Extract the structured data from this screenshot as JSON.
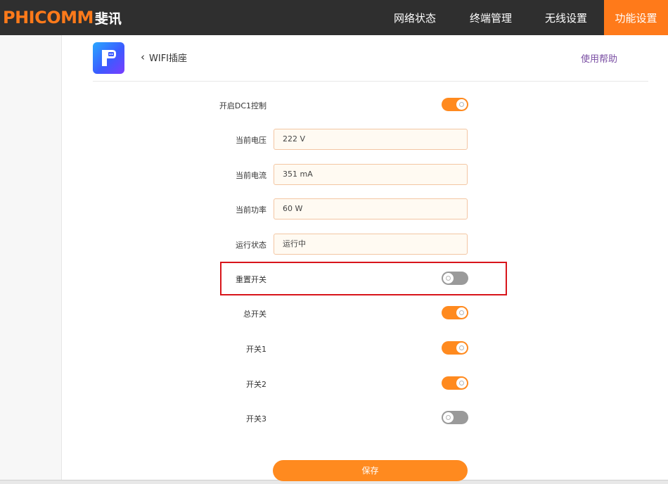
{
  "brand": {
    "name_en": "PHICOMM",
    "name_cn": "斐讯",
    "accent_color": "#ff7a1a"
  },
  "nav": [
    {
      "label": "网络状态",
      "active": false
    },
    {
      "label": "终端管理",
      "active": false
    },
    {
      "label": "无线设置",
      "active": false
    },
    {
      "label": "功能设置",
      "active": true
    }
  ],
  "page": {
    "app_icon": "wifi-plug-icon",
    "back_label": "WIFI插座",
    "help_label": "使用帮助"
  },
  "form": {
    "dc1_control": {
      "label": "开启DC1控制",
      "on": true
    },
    "voltage": {
      "label": "当前电压",
      "value": "222 V"
    },
    "current": {
      "label": "当前电流",
      "value": "351 mA"
    },
    "power": {
      "label": "当前功率",
      "value": "60 W"
    },
    "run_status": {
      "label": "运行状态",
      "value": "运行中"
    },
    "reset_switch": {
      "label": "重置开关",
      "on": false
    },
    "master_switch": {
      "label": "总开关",
      "on": true
    },
    "switch1": {
      "label": "开关1",
      "on": true
    },
    "switch2": {
      "label": "开关2",
      "on": true
    },
    "switch3": {
      "label": "开关3",
      "on": false
    }
  },
  "actions": {
    "save_label": "保存"
  }
}
